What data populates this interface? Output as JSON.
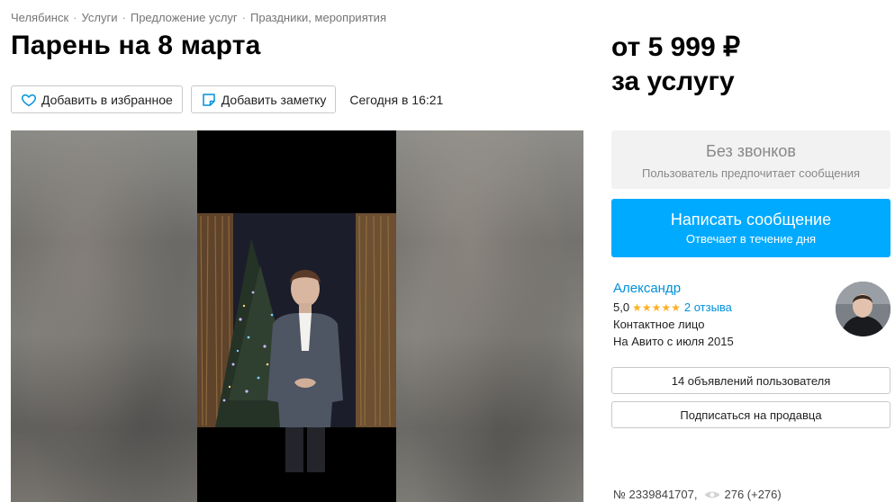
{
  "breadcrumb": [
    "Челябинск",
    "Услуги",
    "Предложение услуг",
    "Праздники, мероприятия"
  ],
  "breadcrumb_sep": "·",
  "title": "Парень на 8 марта",
  "actions": {
    "favorite_label": "Добавить в избранное",
    "note_label": "Добавить заметку",
    "date": "Сегодня в 16:21"
  },
  "price": {
    "line1": "от 5 999 ₽",
    "line2": "за услугу"
  },
  "contact": {
    "no_calls_title": "Без звонков",
    "no_calls_sub": "Пользователь предпочитает сообщения",
    "message_button": "Написать сообщение",
    "message_sub": "Отвечает в течение дня"
  },
  "seller": {
    "name": "Александр",
    "rating": "5,0",
    "stars": "★★★★★",
    "star_color": "#ffb021",
    "reviews": "2 отзыва",
    "role": "Контактное лицо",
    "since": "На Авито с июля 2015"
  },
  "buttons": {
    "listings": "14 объявлений пользователя",
    "subscribe": "Подписаться на продавца"
  },
  "footer": {
    "ad_number": "№ 2339841707,",
    "views": "276 (+276)"
  },
  "colors": {
    "accent": "#00aaff",
    "link": "#0091d9"
  },
  "icons": {
    "favorite": "heart-icon",
    "note": "note-icon",
    "views": "eye-icon"
  }
}
